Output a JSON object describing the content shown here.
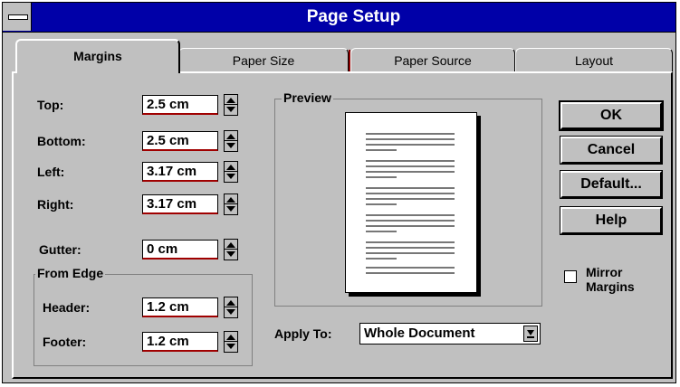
{
  "window": {
    "title": "Page Setup"
  },
  "tabs": [
    {
      "label": "Margins",
      "active": true
    },
    {
      "label": "Paper Size",
      "active": false
    },
    {
      "label": "Paper Source",
      "active": false
    },
    {
      "label": "Layout",
      "active": false
    }
  ],
  "margins": {
    "top": {
      "label": "Top:",
      "value": "2.5 cm"
    },
    "bottom": {
      "label": "Bottom:",
      "value": "2.5 cm"
    },
    "left": {
      "label": "Left:",
      "value": "3.17 cm"
    },
    "right": {
      "label": "Right:",
      "value": "3.17 cm"
    },
    "gutter": {
      "label": "Gutter:",
      "value": "0 cm"
    }
  },
  "from_edge": {
    "title": "From Edge",
    "header": {
      "label": "Header:",
      "value": "1.2 cm"
    },
    "footer": {
      "label": "Footer:",
      "value": "1.2 cm"
    }
  },
  "preview": {
    "title": "Preview"
  },
  "apply_to": {
    "label": "Apply To:",
    "value": "Whole Document"
  },
  "buttons": {
    "ok": "OK",
    "cancel": "Cancel",
    "default": "Default...",
    "help": "Help"
  },
  "mirror_margins": {
    "label_line1": "Mirror",
    "label_line2": "Margins",
    "checked": false
  },
  "colors": {
    "titlebar": "#0000a8",
    "face": "#c0c0c0",
    "field_accent": "#a00000"
  }
}
